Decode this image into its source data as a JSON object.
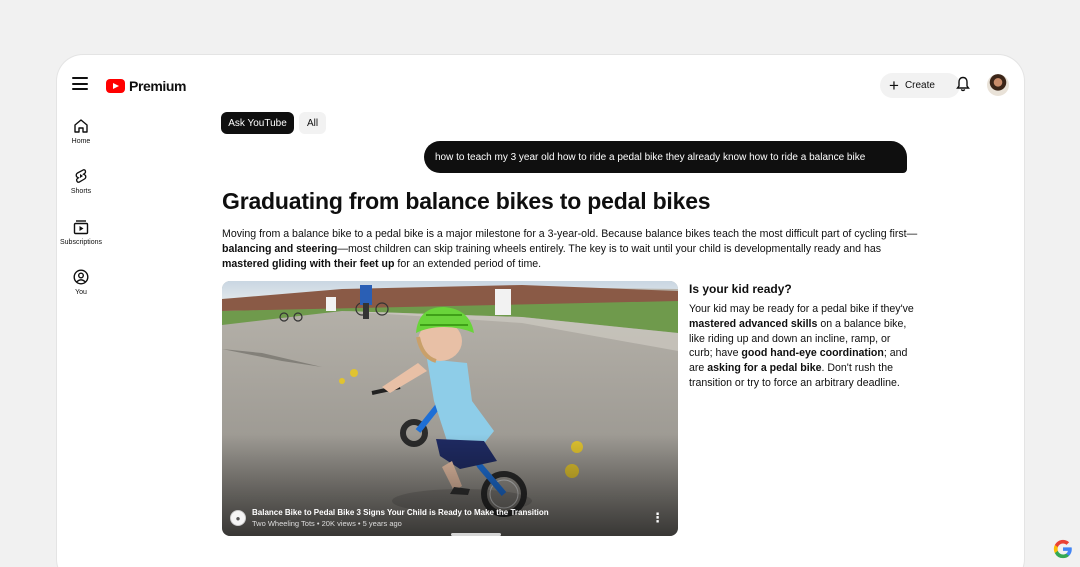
{
  "header": {
    "logo_text": "Premium",
    "create_label": "Create"
  },
  "sidebar": {
    "items": [
      {
        "label": "Home",
        "icon": "home-icon"
      },
      {
        "label": "Shorts",
        "icon": "shorts-icon"
      },
      {
        "label": "Subscriptions",
        "icon": "subscriptions-icon"
      },
      {
        "label": "You",
        "icon": "you-icon"
      }
    ]
  },
  "chips": {
    "ask": "Ask YouTube",
    "all": "All"
  },
  "query": "how to teach my 3 year old how to ride a pedal bike they already know how to ride a balance bike",
  "answer": {
    "title": "Graduating from balance bikes to pedal bikes",
    "summary": {
      "p1": "Moving from a balance bike to a pedal bike is a major milestone for a 3-year-old. Because balance bikes teach the most difficult part of cycling first—",
      "b1": "balancing and steering",
      "p2": "—most children can skip training wheels entirely. The key is to wait until your child is developmentally ready and has ",
      "b2": "mastered gliding with their feet up",
      "p3": " for an extended period of time."
    },
    "side_title": "Is your kid ready?",
    "side": {
      "p1": "Your kid may be ready for a pedal bike if they've ",
      "b1": "mastered advanced skills",
      "p2": " on a balance bike, like riding up and down an incline, ramp, or curb; have ",
      "b2": "good hand-eye coordination",
      "p3": "; and are ",
      "b3": "asking for a pedal bike",
      "p4": ". Don't rush the transition or try to force an arbitrary deadline."
    }
  },
  "video": {
    "title": "Balance Bike to Pedal Bike 3 Signs Your Child is Ready to Make the Transition",
    "channel": "Two Wheeling Tots",
    "views": "20K views",
    "age": "5 years ago",
    "sep": "•"
  },
  "colors": {
    "brand_red": "#ff0000",
    "query_bg": "#0f0f0f",
    "chip_active_bg": "#0f0f0f"
  }
}
